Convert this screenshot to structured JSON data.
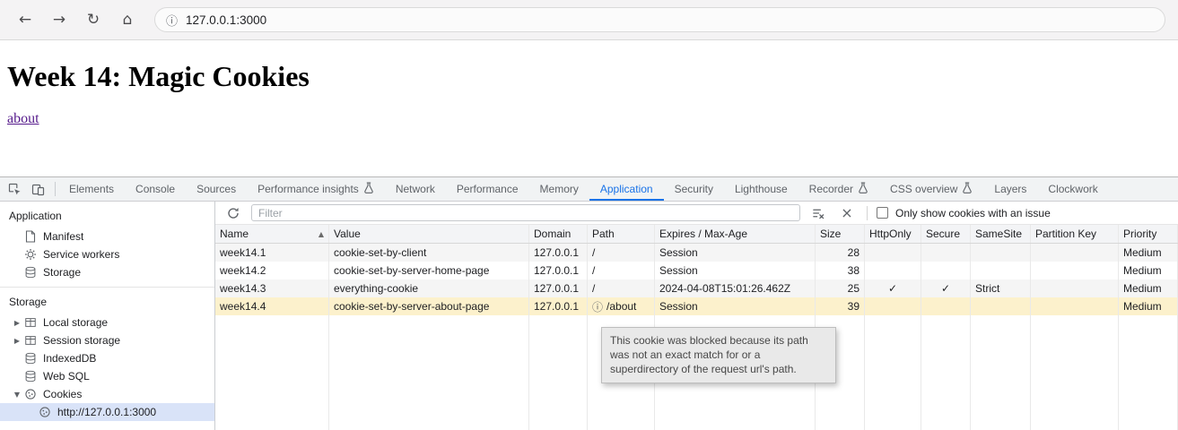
{
  "browser": {
    "url": "127.0.0.1:3000"
  },
  "page": {
    "heading": "Week 14: Magic Cookies",
    "link": "about"
  },
  "icons": {
    "back": "←",
    "forward": "→",
    "reload": "↻",
    "home": "⌂",
    "info": "ⓘ",
    "close": "×",
    "collapsed": "▶",
    "expanded": "▼",
    "sort_ascending": "▲",
    "blocked_info": "ⓘ"
  },
  "devtools": {
    "tabs": [
      {
        "label": "Elements"
      },
      {
        "label": "Console"
      },
      {
        "label": "Sources"
      },
      {
        "label": "Performance insights",
        "experimental": true
      },
      {
        "label": "Network"
      },
      {
        "label": "Performance"
      },
      {
        "label": "Memory"
      },
      {
        "label": "Application",
        "active": true
      },
      {
        "label": "Security"
      },
      {
        "label": "Lighthouse"
      },
      {
        "label": "Recorder",
        "experimental": true
      },
      {
        "label": "CSS overview",
        "experimental": true
      },
      {
        "label": "Layers"
      },
      {
        "label": "Clockwork"
      }
    ],
    "sidebar": {
      "section_application": {
        "title": "Application",
        "items": [
          {
            "label": "Manifest",
            "icon": "document"
          },
          {
            "label": "Service workers",
            "icon": "gear"
          },
          {
            "label": "Storage",
            "icon": "database"
          }
        ]
      },
      "section_storage": {
        "title": "Storage",
        "items": [
          {
            "label": "Local storage",
            "icon": "table",
            "state": "collapsed"
          },
          {
            "label": "Session storage",
            "icon": "table",
            "state": "collapsed"
          },
          {
            "label": "IndexedDB",
            "icon": "database"
          },
          {
            "label": "Web SQL",
            "icon": "database"
          },
          {
            "label": "Cookies",
            "icon": "cookie",
            "state": "expanded"
          },
          {
            "label": "http://127.0.0.1:3000",
            "icon": "cookie",
            "selected": true
          }
        ]
      }
    },
    "cookies_panel": {
      "filter_placeholder": "Filter",
      "only_issues_label": "Only show cookies with an issue",
      "columns": {
        "name": "Name",
        "value": "Value",
        "domain": "Domain",
        "path": "Path",
        "expires": "Expires / Max-Age",
        "size": "Size",
        "httponly": "HttpOnly",
        "secure": "Secure",
        "samesite": "SameSite",
        "partition_key": "Partition Key",
        "priority": "Priority"
      },
      "rows": [
        {
          "name": "week14.1",
          "value": "cookie-set-by-client",
          "domain": "127.0.0.1",
          "path": "/",
          "expires": "Session",
          "size": "28",
          "httponly": "",
          "secure": "",
          "samesite": "",
          "partition_key": "",
          "priority": "Medium"
        },
        {
          "name": "week14.2",
          "value": "cookie-set-by-server-home-page",
          "domain": "127.0.0.1",
          "path": "/",
          "expires": "Session",
          "size": "38",
          "httponly": "",
          "secure": "",
          "samesite": "",
          "partition_key": "",
          "priority": "Medium"
        },
        {
          "name": "week14.3",
          "value": "everything-cookie",
          "domain": "127.0.0.1",
          "path": "/",
          "expires": "2024-04-08T15:01:26.462Z",
          "size": "25",
          "httponly": "✓",
          "secure": "✓",
          "samesite": "Strict",
          "partition_key": "",
          "priority": "Medium"
        },
        {
          "name": "week14.4",
          "value": "cookie-set-by-server-about-page",
          "domain": "127.0.0.1",
          "path": "/about",
          "expires": "Session",
          "size": "39",
          "httponly": "",
          "secure": "",
          "samesite": "",
          "partition_key": "",
          "priority": "Medium",
          "blocked": true
        }
      ],
      "tooltip": "This cookie was blocked because its path was not an exact match for or a superdirectory of the request url's path."
    }
  }
}
